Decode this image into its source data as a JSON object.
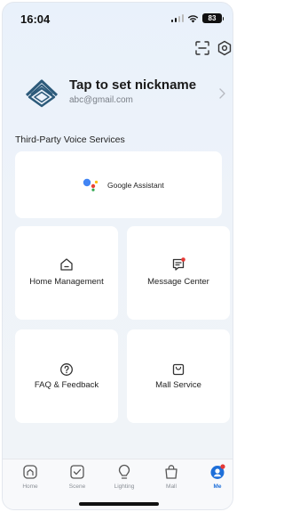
{
  "status_bar": {
    "time": "16:04",
    "battery": "83"
  },
  "profile": {
    "nickname": "Tap to set nickname",
    "email": "abc@gmail.com"
  },
  "voice_services": {
    "title": "Third-Party Voice Services",
    "google_assistant_label": "Google Assistant"
  },
  "tiles": {
    "home_management": "Home Management",
    "message_center": "Message Center",
    "faq_feedback": "FAQ & Feedback",
    "mall_service": "Mall Service"
  },
  "tab_bar": {
    "home": "Home",
    "scene": "Scene",
    "lighting": "Lighting",
    "mall": "Mall",
    "me": "Me",
    "active": "me"
  },
  "colors": {
    "accent": "#1e6fd9",
    "notification": "#e53935",
    "logo": "#2c5a7a"
  },
  "icons": {
    "top_left": "scan-icon",
    "top_right": "settings-icon"
  }
}
